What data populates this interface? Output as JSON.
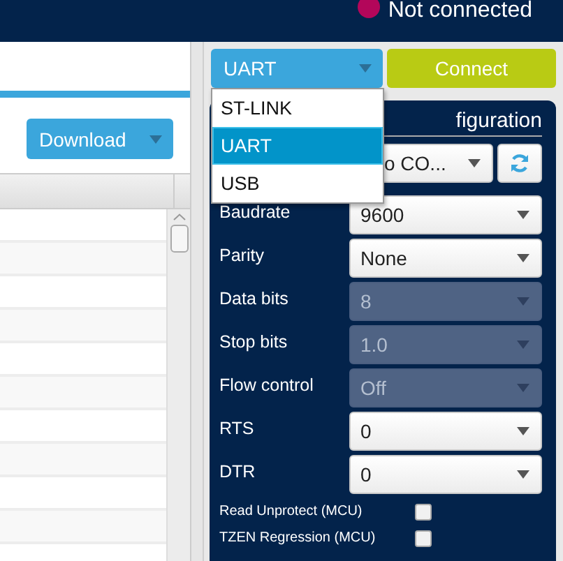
{
  "status": {
    "text": "Not connected",
    "color": "#b3065a"
  },
  "left_pane": {
    "download_button": "Download"
  },
  "connection": {
    "interface": "UART",
    "expanded": true,
    "options": [
      {
        "label": "ST-LINK",
        "selected": false
      },
      {
        "label": "UART",
        "selected": true
      },
      {
        "label": "USB",
        "selected": false
      }
    ],
    "connect_button": "Connect"
  },
  "configuration": {
    "title": "figuration",
    "port": "o CO...",
    "fields": [
      {
        "label": "Baudrate",
        "value": "9600",
        "disabled": false
      },
      {
        "label": "Parity",
        "value": "None",
        "disabled": false
      },
      {
        "label": "Data bits",
        "value": "8",
        "disabled": true
      },
      {
        "label": "Stop bits",
        "value": "1.0",
        "disabled": true
      },
      {
        "label": "Flow control",
        "value": "Off",
        "disabled": true
      },
      {
        "label": "RTS",
        "value": "0",
        "disabled": false
      },
      {
        "label": "DTR",
        "value": "0",
        "disabled": false
      }
    ],
    "checkboxes": [
      {
        "label": "Read Unprotect (MCU)",
        "checked": false
      },
      {
        "label": "TZEN Regression (MCU)",
        "checked": false
      }
    ]
  }
}
